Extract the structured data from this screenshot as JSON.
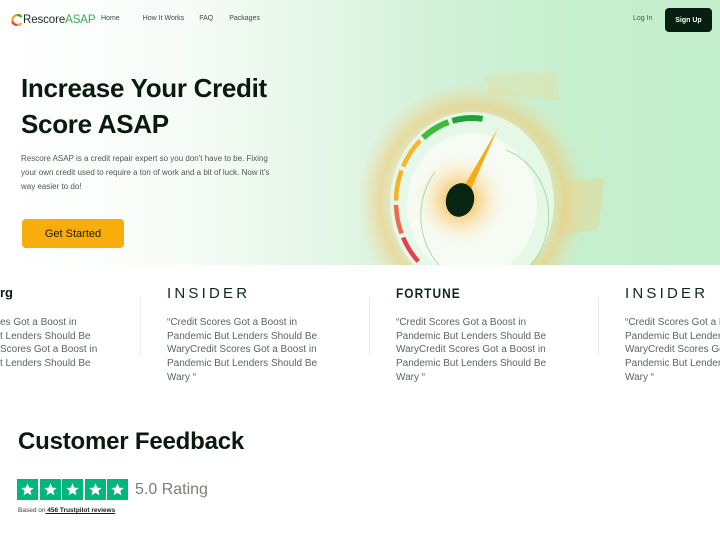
{
  "nav": {
    "logo_main": "Rescore",
    "logo_accent": "ASAP",
    "links": [
      "Home",
      "How It Works",
      "FAQ",
      "Packages"
    ],
    "login": "Log In",
    "signup": "Sign Up"
  },
  "hero": {
    "title_line1": "Increase Your Credit",
    "title_line2": "Score ASAP",
    "description": "Rescore ASAP is a credit repair expert so you don't have to be. Fixing your own credit used to require a ton of work and a bit of luck. Now it's way easier to do!",
    "cta": "Get Started",
    "gauge_segment_colors": [
      "#e2404b",
      "#ec6a4e",
      "#f4b227",
      "#f9b52a",
      "#3dbb3a",
      "#1fa23c"
    ],
    "needle_color": "#f8ab15",
    "hub_color": "#062512"
  },
  "press": [
    {
      "outlet": "Bloomberg",
      "visible_outlet": "rg",
      "quote_lines": [
        "es Got a Boost in",
        "t Lenders Should Be",
        "Scores Got a Boost in",
        "t Lenders Should Be"
      ]
    },
    {
      "outlet": "INSIDER",
      "quote": "“Credit Scores Got a Boost in Pandemic But Lenders Should Be WaryCredit Scores Got a Boost in Pandemic But Lenders Should Be Wary “"
    },
    {
      "outlet": "FORTUNE",
      "quote": "“Credit Scores Got a Boost in Pandemic But Lenders Should Be WaryCredit Scores Got a Boost in Pandemic But Lenders Should Be Wary “"
    },
    {
      "outlet": "INSIDER",
      "quote": "“Credit Scores Got a Boost in Pandemic But Lenders Should Be WaryCredit Scores Got a Boost in Pandemic But Lenders Should Be Wary “"
    }
  ],
  "feedback": {
    "title": "Customer Feedback",
    "stars": 5,
    "rating_text": "5.0 Rating",
    "based_prefix": "Based on",
    "reviews_link": " 456 Trustpilot reviews",
    "star_color": "#00b67a"
  }
}
